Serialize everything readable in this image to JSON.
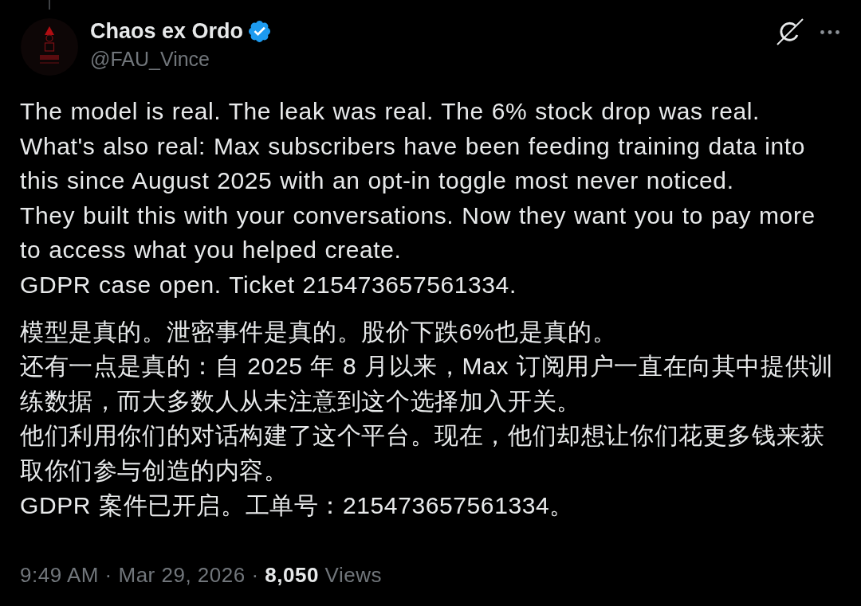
{
  "author": {
    "name": "Chaos ex Ordo",
    "verified": true,
    "handle": "@FAU_Vince"
  },
  "body": [
    [
      "The model is real. The leak was real. The 6% stock drop was real.",
      "What's also real: Max subscribers have been feeding training data into this since August 2025 with an opt-in toggle most never noticed.",
      "They built this with your conversations. Now they want you to pay more to access what you helped create.",
      "GDPR case open. Ticket 215473657561334."
    ],
    [
      "模型是真的。泄密事件是真的。股价下跌6%也是真的。",
      "还有一点是真的：自 2025 年 8 月以来，Max 订阅用户一直在向其中提供训练数据，而大多数人从未注意到这个选择加入开关。",
      "他们利用你们的对话构建了这个平台。现在，他们却想让你们花更多钱来获取你们参与创造的内容。",
      "GDPR 案件已开启。工单号：215473657561334。"
    ]
  ],
  "meta": "9:49 AM · Mar 29, 2026 · **8,050** Views"
}
